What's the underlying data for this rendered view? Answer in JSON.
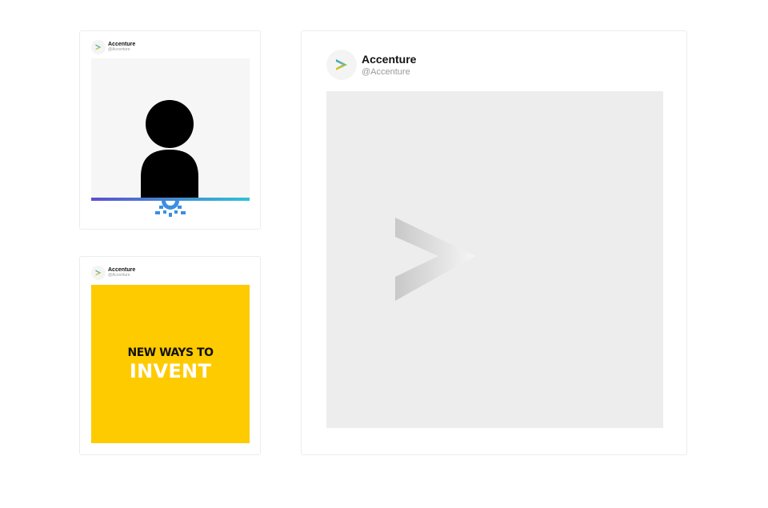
{
  "posts": [
    {
      "author": "Accenture",
      "handle": "@Accenture",
      "media": "person-silhouette-with-gear"
    },
    {
      "author": "Accenture",
      "handle": "@Accenture",
      "media": "yellow-text-graphic",
      "headline_line1": "NEW WAYS TO",
      "headline_line2": "INVENT"
    },
    {
      "author": "Accenture",
      "handle": "@Accenture",
      "media": "accenture-chevron-graphic"
    }
  ],
  "icons": {
    "logo": "accenture-chevron-icon",
    "gear": "gear-icon"
  },
  "colors": {
    "brand_yellow": "#fecb00",
    "brand_blue": "#1aa7e8",
    "gear_blue": "#3b8fe0",
    "gradient_start": "#5b4fd1",
    "gradient_end": "#2ec2d6"
  }
}
